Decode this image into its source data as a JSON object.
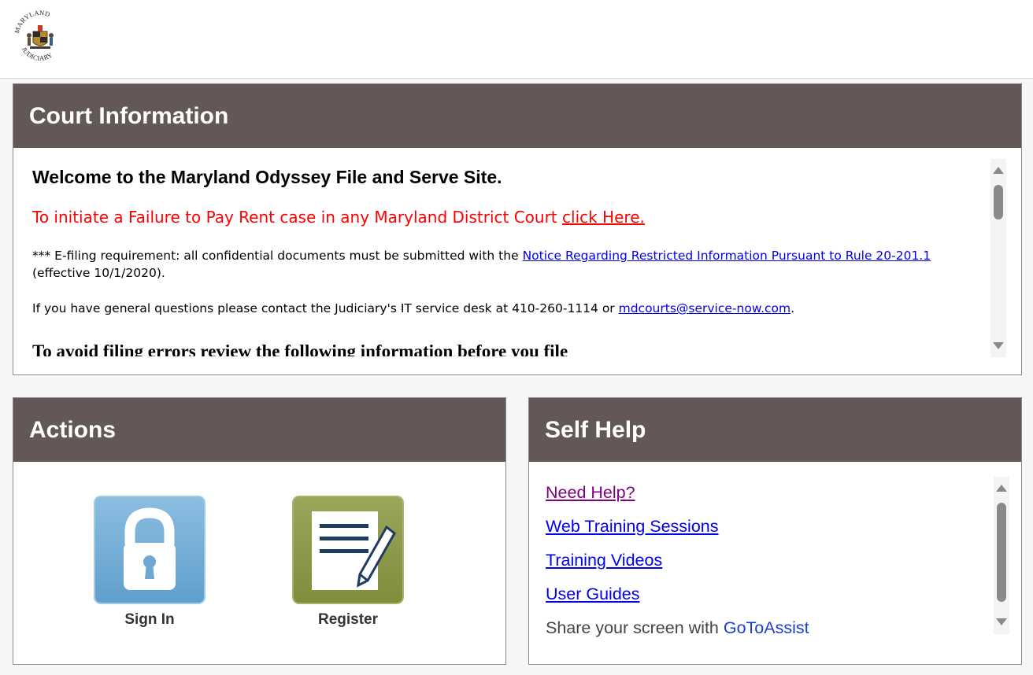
{
  "header": {
    "logo_top_text": "MARYLAND",
    "logo_bottom_text": "JUDICIARY"
  },
  "court_info": {
    "title": "Court Information",
    "welcome": "Welcome to the Maryland Odyssey File and Serve Site.",
    "fail_to_pay_text": "To initiate a Failure to Pay Rent case in any Maryland District Court ",
    "fail_to_pay_link": "click Here.",
    "efiling_prefix": "*** E-filing requirement: all confidential documents must be submitted with the ",
    "efiling_link": "Notice Regarding Restricted Information Pursuant to Rule 20-201.1",
    "efiling_suffix": " (effective 10/1/2020).",
    "questions_prefix": "If you have general questions please contact the Judiciary's IT service desk at 410-260-1114 or ",
    "questions_link": "mdcourts@service-now.com",
    "questions_suffix": ".",
    "cut_off_text": "To avoid filing errors review the following information before you file"
  },
  "actions": {
    "title": "Actions",
    "sign_in_label": "Sign In",
    "register_label": "Register"
  },
  "self_help": {
    "title": "Self Help",
    "items": [
      {
        "label": "Need Help?"
      },
      {
        "label": "Web Training Sessions"
      },
      {
        "label": "Training Videos"
      },
      {
        "label": "User Guides"
      }
    ],
    "share_prefix": "Share your screen with ",
    "share_link": "GoToAssist"
  },
  "colors": {
    "header_bg": "#635857",
    "alert_red": "#ff0000",
    "link_blue": "#0000ee",
    "visited_purple": "#800080",
    "signin_blue": "#6fa8d0",
    "register_olive": "#8c9a4a"
  },
  "icons": [
    "maryland-judiciary-seal-icon",
    "padlock-icon",
    "document-pen-icon"
  ]
}
